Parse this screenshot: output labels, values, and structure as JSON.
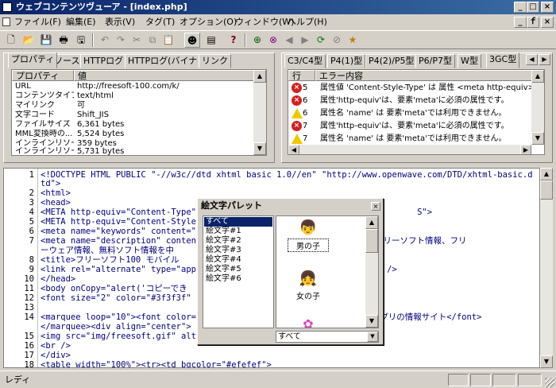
{
  "window": {
    "title": "ウェブコンテンツヴューア - [index.php]",
    "controls": [
      "_",
      "□",
      "×"
    ],
    "mdi_controls": [
      "_",
      "ｆ",
      "×"
    ]
  },
  "menubar": [
    "ファイル(F)",
    "編集(E)",
    "表示(V)",
    "タグ(T)",
    "オプション(O)",
    "ウィンドウ(W)",
    "ヘルプ(H)"
  ],
  "toolbar": {
    "buttons": [
      {
        "icon": "new-doc-icon",
        "glyph": "🗋"
      },
      {
        "icon": "open-folder-icon",
        "glyph": "📂"
      },
      {
        "icon": "save-icon",
        "glyph": "💾"
      },
      {
        "icon": "print-icon",
        "glyph": "🖶"
      },
      {
        "icon": "floppy-icon",
        "glyph": "🖫"
      },
      {
        "icon": "undo-icon",
        "glyph": "↶"
      },
      {
        "icon": "redo-icon",
        "glyph": "↷"
      },
      {
        "icon": "cut-icon",
        "glyph": "✂"
      },
      {
        "icon": "copy-icon",
        "glyph": "⧉"
      },
      {
        "icon": "paste-icon",
        "glyph": "📋"
      },
      {
        "icon": "emoji-palette-icon",
        "glyph": "☻"
      },
      {
        "icon": "properties-icon",
        "glyph": "▤"
      },
      {
        "icon": "help-icon",
        "glyph": "?"
      },
      {
        "icon": "browser-icon",
        "glyph": "⊕"
      },
      {
        "icon": "browser-alt-icon",
        "glyph": "⊗"
      },
      {
        "icon": "back-icon",
        "glyph": "◀"
      },
      {
        "icon": "forward-icon",
        "glyph": "▶"
      },
      {
        "icon": "refresh-icon",
        "glyph": "⟳"
      },
      {
        "icon": "stop-icon",
        "glyph": "⊘"
      },
      {
        "icon": "favorites-icon",
        "glyph": "★"
      }
    ]
  },
  "left_panel": {
    "tabs": [
      "プロパティ",
      "ソース",
      "HTTPログ",
      "HTTPログ(バイナリ)",
      "リンク"
    ],
    "active_tab": 0,
    "columns": [
      "プロパティ",
      "値"
    ],
    "rows": [
      {
        "k": "URL",
        "v": "http://freesoft-100.com/k/"
      },
      {
        "k": "コンテンツタイプ",
        "v": "text/html"
      },
      {
        "k": "マイリンク",
        "v": "可"
      },
      {
        "k": "文字コード",
        "v": "Shift_JIS"
      },
      {
        "k": "ファイルサイズ",
        "v": "6,361 bytes"
      },
      {
        "k": "MML変換時の...",
        "v": "5,524 bytes"
      },
      {
        "k": "インラインリソー...",
        "v": "359 bytes"
      },
      {
        "k": "インラインリソー...",
        "v": "5,731 bytes"
      }
    ]
  },
  "right_panel": {
    "tabs": [
      "C3/C4型",
      "P4(1)型",
      "P4(2)/P5型",
      "P6/P7型",
      "W型",
      "3GC型"
    ],
    "active_tab": 5,
    "columns": [
      "行",
      "エラー内容"
    ],
    "rows": [
      {
        "type": "error",
        "line": "5",
        "msg": "属性値 'Content-Style-Type' は 属性 <meta http-equiv>"
      },
      {
        "type": "error",
        "line": "6",
        "msg": "属性'http-equiv'は、要素'meta'に必須の属性です。"
      },
      {
        "type": "warning",
        "line": "6",
        "msg": "属性名 'name' は 要素'meta'では利用できません。"
      },
      {
        "type": "error",
        "line": "7",
        "msg": "属性'http-equiv'は、要素'meta'に必須の属性です。"
      },
      {
        "type": "warning",
        "line": "7",
        "msg": "属性名 'name' は 要素'meta'では利用できません。"
      }
    ]
  },
  "editor": {
    "lines": [
      {
        "no": "1",
        "text": "<!DOCTYPE HTML PUBLIC \"-//w3c//dtd xhtml basic 1.0//en\" \"http://www.openwave.com/DTD/xhtml-basic.d"
      },
      {
        "no": "",
        "text": "td\">"
      },
      {
        "no": "2",
        "text": "<html>"
      },
      {
        "no": "3",
        "text": "<head>"
      },
      {
        "no": "4",
        "text": "<META http-equiv=\"Content-Type\"                                            S\">"
      },
      {
        "no": "5",
        "text": "<META http-equiv=\"Content-Style"
      },
      {
        "no": "6",
        "text": "<meta name=\"keywords\" content=\""
      },
      {
        "no": "7",
        "text": "<meta name=\"description\" conten                             で使えるフリーソフト情報、フリ"
      },
      {
        "no": "",
        "text": "ーウェア情報、無料ソフト情報を中"
      },
      {
        "no": "8",
        "text": "<title>フリーソフト100 モバイル"
      },
      {
        "no": "9",
        "text": "<link rel=\"alternate\" type=\"app                              or.xml\" />"
      },
      {
        "no": "10",
        "text": "</head>"
      },
      {
        "no": "11",
        "text": "<body onCopy=\"alert('コピーでき"
      },
      {
        "no": "12",
        "text": "<font size=\"2\" color=\"#3f3f3f\""
      },
      {
        "no": "13",
        "text": ""
      },
      {
        "no": "14",
        "text": "<marquee loop=\"10\"><font color=                              フリーアプリの情報サイト</font>"
      },
      {
        "no": "",
        "text": "</marquee><div align=\"center\">"
      },
      {
        "no": "15",
        "text": "<img src=\"img/freesoft.gif\" alt"
      },
      {
        "no": "16",
        "text": "<br />"
      },
      {
        "no": "17",
        "text": "</div>"
      },
      {
        "no": "18",
        "text": "<table width=\"100%\"><tr><td bgcolor=\"#efefef\">"
      }
    ]
  },
  "palette": {
    "title": "絵文字パレット",
    "categories": [
      "すべて",
      "絵文字#1",
      "絵文字#2",
      "絵文字#3",
      "絵文字#4",
      "絵文字#5",
      "絵文字#6"
    ],
    "selected_category": 0,
    "items": [
      {
        "label": "男の子",
        "icon": "boy-emoji-icon",
        "glyph": "👦"
      },
      {
        "label": "女の子",
        "icon": "girl-emoji-icon",
        "glyph": "👧"
      },
      {
        "label": "",
        "icon": "pink-emoji-icon",
        "glyph": "✿"
      }
    ],
    "dropdown_value": "すべて"
  },
  "statusbar": {
    "text": "レディ"
  },
  "colors": {
    "titlebar_start": "#0a246a",
    "titlebar_end": "#3a6ea5",
    "face": "#d4d0c8",
    "selection": "#0a246a",
    "code": "#000080"
  }
}
